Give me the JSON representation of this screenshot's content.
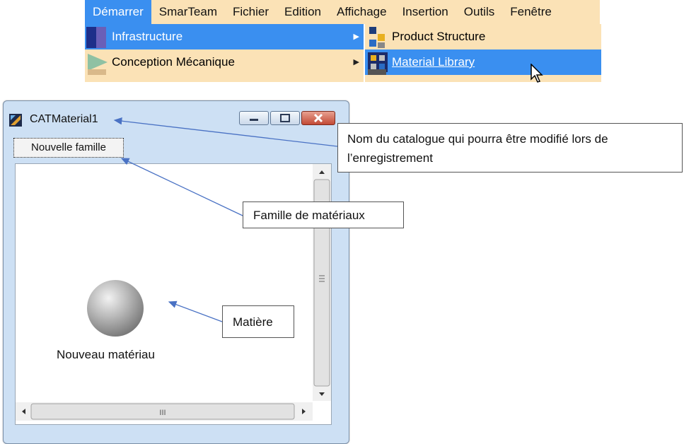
{
  "menubar": {
    "items": [
      {
        "label": "Démarrer",
        "active": true
      },
      {
        "label": "SmarTeam",
        "active": false
      },
      {
        "label": "Fichier",
        "active": false
      },
      {
        "label": "Edition",
        "active": false
      },
      {
        "label": "Affichage",
        "active": false
      },
      {
        "label": "Insertion",
        "active": false
      },
      {
        "label": "Outils",
        "active": false
      },
      {
        "label": "Fenêtre",
        "active": false
      }
    ]
  },
  "dropdown": {
    "items": [
      {
        "label": "Infrastructure",
        "icon": "infrastructure-icon",
        "has_submenu": true,
        "active": true
      },
      {
        "label": "Conception Mécanique",
        "icon": "mechanical-design-icon",
        "has_submenu": true,
        "active": false
      }
    ]
  },
  "submenu": {
    "items": [
      {
        "label": "Product Structure",
        "icon": "product-structure-icon",
        "active": false
      },
      {
        "label": "Material Library",
        "icon": "material-library-icon",
        "active": true
      }
    ]
  },
  "window": {
    "title": "CATMaterial1",
    "tab_label": "Nouvelle famille",
    "material_label": "Nouveau matériau",
    "hscroll_grip": "III"
  },
  "callouts": {
    "catalog_name": "Nom du catalogue qui pourra être modifié lors de l’enregistrement",
    "family": "Famille de matériaux",
    "material": "Matière"
  },
  "colors": {
    "menu_bg": "#fbe2b6",
    "highlight": "#3a8ff0",
    "window_frame": "#cde0f4",
    "arrow": "#4a72c4"
  }
}
